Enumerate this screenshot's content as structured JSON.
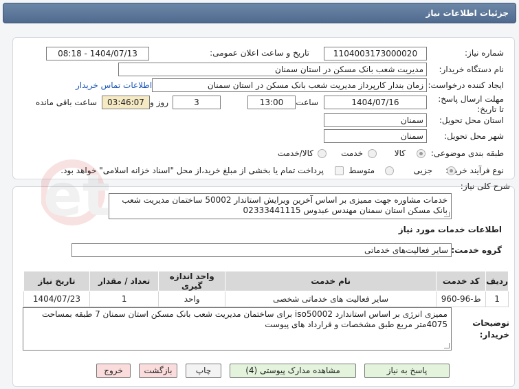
{
  "window": {
    "title": "جزئیات اطلاعات نیاز"
  },
  "details": {
    "need_number_label": "شماره نیاز:",
    "need_number": "1104003173000020",
    "announce_label": "تاریخ و ساعت اعلان عمومی:",
    "announce_value": "1404/07/13 - 08:18",
    "buyer_label": "نام دستگاه خریدار:",
    "buyer_value": "مدیریت شعب بانک مسکن در استان سمنان",
    "creator_label": "ایجاد کننده درخواست:",
    "creator_value": "زمان بندار کارپرداز مدیریت شعب بانک مسکن در استان سمنان",
    "contact_link": "اطلاعات تماس خریدار",
    "deadline_label": "مهلت ارسال پاسخ: تا تاریخ:",
    "deadline_date": "1404/07/16",
    "time_label": "ساعت",
    "deadline_time": "13:00",
    "days_value": "3",
    "days_label": "روز و",
    "remaining_time": "03:46:07",
    "remaining_label": "ساعت باقی مانده",
    "province_label": "استان محل تحویل:",
    "province_value": "سمنان",
    "city_label": "شهر محل تحویل:",
    "city_value": "سمنان",
    "category_label": "طبقه بندی موضوعی:",
    "category_options": [
      "کالا",
      "خدمت",
      "کالا/خدمت"
    ],
    "process_label": "نوع فرآیند خرید :",
    "process_options": [
      "جزیی",
      "متوسط"
    ],
    "payment_note": "پرداخت تمام یا بخشی از مبلغ خرید،از محل \"اسناد خزانه اسلامی\" خواهد بود."
  },
  "need": {
    "summary_label": "شرح کلی نیاز:",
    "summary_text": "خدمات مشاوره جهت ممیزی بر اساس آخرین ویرایش استاندار 50002 ساختمان مدیریت شعب بانک مسکن استان سمنان مهندس عبدوس 02333441115",
    "services_heading": "اطلاعات خدمات مورد نیاز",
    "service_group_label": "گروه خدمت:",
    "service_group_value": "سایر فعالیت‌های خدماتی"
  },
  "table": {
    "headers": [
      "ردیف",
      "کد خدمت",
      "نام خدمت",
      "واحد اندازه گیری",
      "تعداد / مقدار",
      "تاریخ نیاز"
    ],
    "rows": [
      [
        "1",
        "ط-96-960",
        "سایر فعالیت های خدماتی شخصی",
        "واحد",
        "1",
        "1404/07/23"
      ]
    ]
  },
  "buyer_notes": {
    "label": "توضیحات خریدار:",
    "text": "ممیزی انرژی بر اساس استاندارد iso50002  برای ساختمان مدیریت شعب بانک مسکن استان سمنان 7 طبقه بمساحت 4075متر مربع طبق مشخصات و قرارداد های پیوست"
  },
  "buttons": {
    "reply": "پاسخ به نیاز",
    "attachments": "مشاهده مدارک پیوستی (4)",
    "print": "چاپ",
    "back": "بازگشت",
    "exit": "خروج"
  },
  "watermark": {
    "text": "AriaTender.net"
  }
}
